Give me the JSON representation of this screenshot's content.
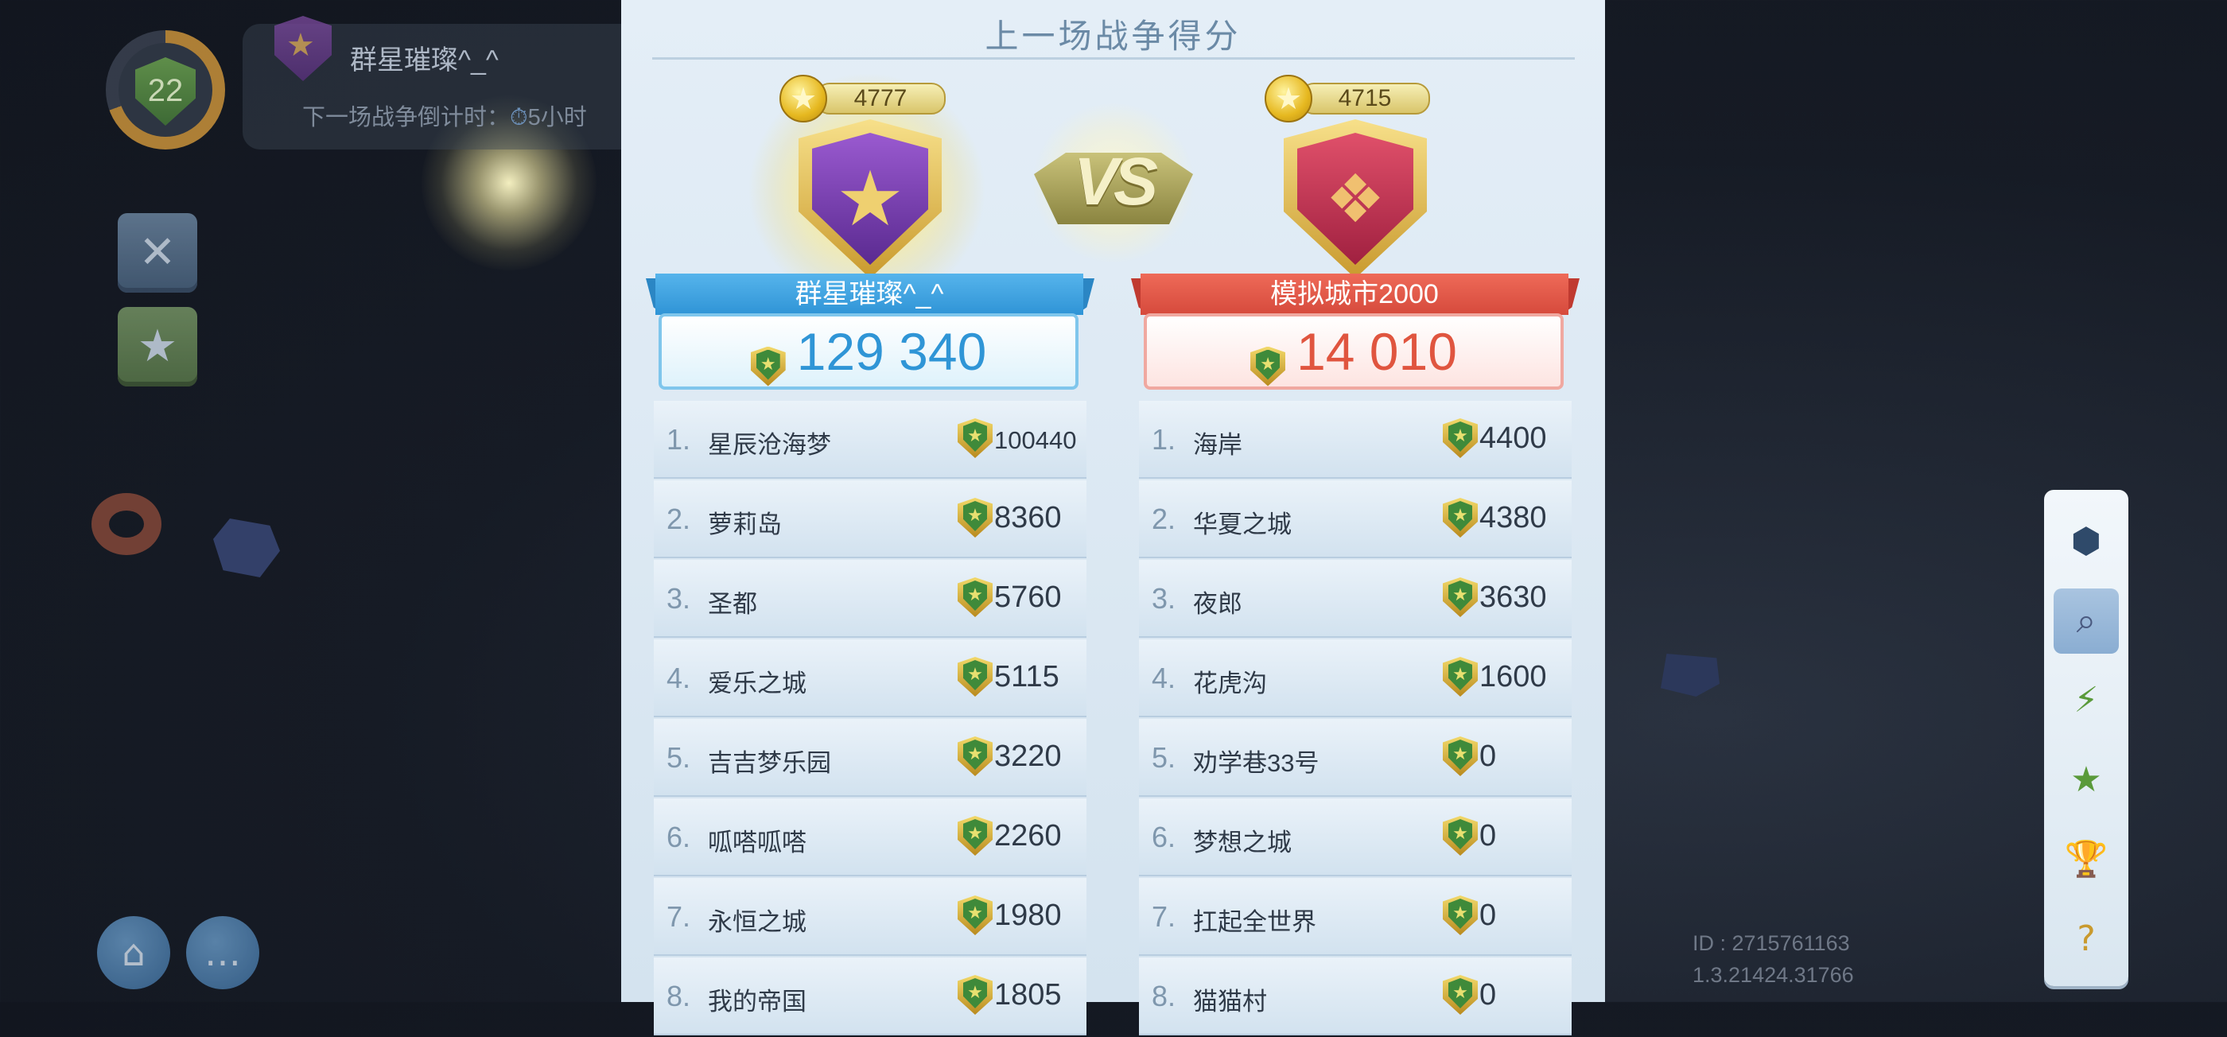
{
  "hud": {
    "level": "22",
    "player_name": "群星璀璨^_^",
    "countdown_label": "下一场战争倒计时：",
    "countdown_value": "5小时",
    "id_text": "ID : 2715761163",
    "version_text": "1.3.21424.31766"
  },
  "panel": {
    "title": "上一场战争得分"
  },
  "left_team": {
    "name": "群星璀璨^_^",
    "badge_score": "4777",
    "total": "129 340",
    "accent": "#3ea0e0",
    "members": [
      {
        "rank": "1.",
        "name": "星辰沧海梦",
        "score": "100440"
      },
      {
        "rank": "2.",
        "name": "萝莉岛",
        "score": "8360"
      },
      {
        "rank": "3.",
        "name": "圣都",
        "score": "5760"
      },
      {
        "rank": "4.",
        "name": "爱乐之城",
        "score": "5115"
      },
      {
        "rank": "5.",
        "name": "吉吉梦乐园",
        "score": "3220"
      },
      {
        "rank": "6.",
        "name": "呱嗒呱嗒",
        "score": "2260"
      },
      {
        "rank": "7.",
        "name": "永恒之城",
        "score": "1980"
      },
      {
        "rank": "8.",
        "name": "我的帝国",
        "score": "1805"
      }
    ]
  },
  "right_team": {
    "name": "模拟城市2000",
    "badge_score": "4715",
    "total": "14 010",
    "accent": "#e05545",
    "members": [
      {
        "rank": "1.",
        "name": "海岸",
        "score": "4400"
      },
      {
        "rank": "2.",
        "name": "华夏之城",
        "score": "4380"
      },
      {
        "rank": "3.",
        "name": "夜郎",
        "score": "3630"
      },
      {
        "rank": "4.",
        "name": "花虎沟",
        "score": "1600"
      },
      {
        "rank": "5.",
        "name": "劝学巷33号",
        "score": "0"
      },
      {
        "rank": "6.",
        "name": "梦想之城",
        "score": "0"
      },
      {
        "rank": "7.",
        "name": "扛起全世界",
        "score": "0"
      },
      {
        "rank": "8.",
        "name": "猫猫村",
        "score": "0"
      }
    ]
  },
  "vs_label": "VS",
  "icons": {
    "tools": "tools-icon",
    "shop": "shop-bag-icon",
    "home": "home-icon",
    "chat": "chat-icon",
    "toolbar": [
      "war-headquarters-icon",
      "search-icon",
      "speed-card-icon",
      "star-card-icon",
      "trophy-icon",
      "help-book-icon"
    ]
  }
}
